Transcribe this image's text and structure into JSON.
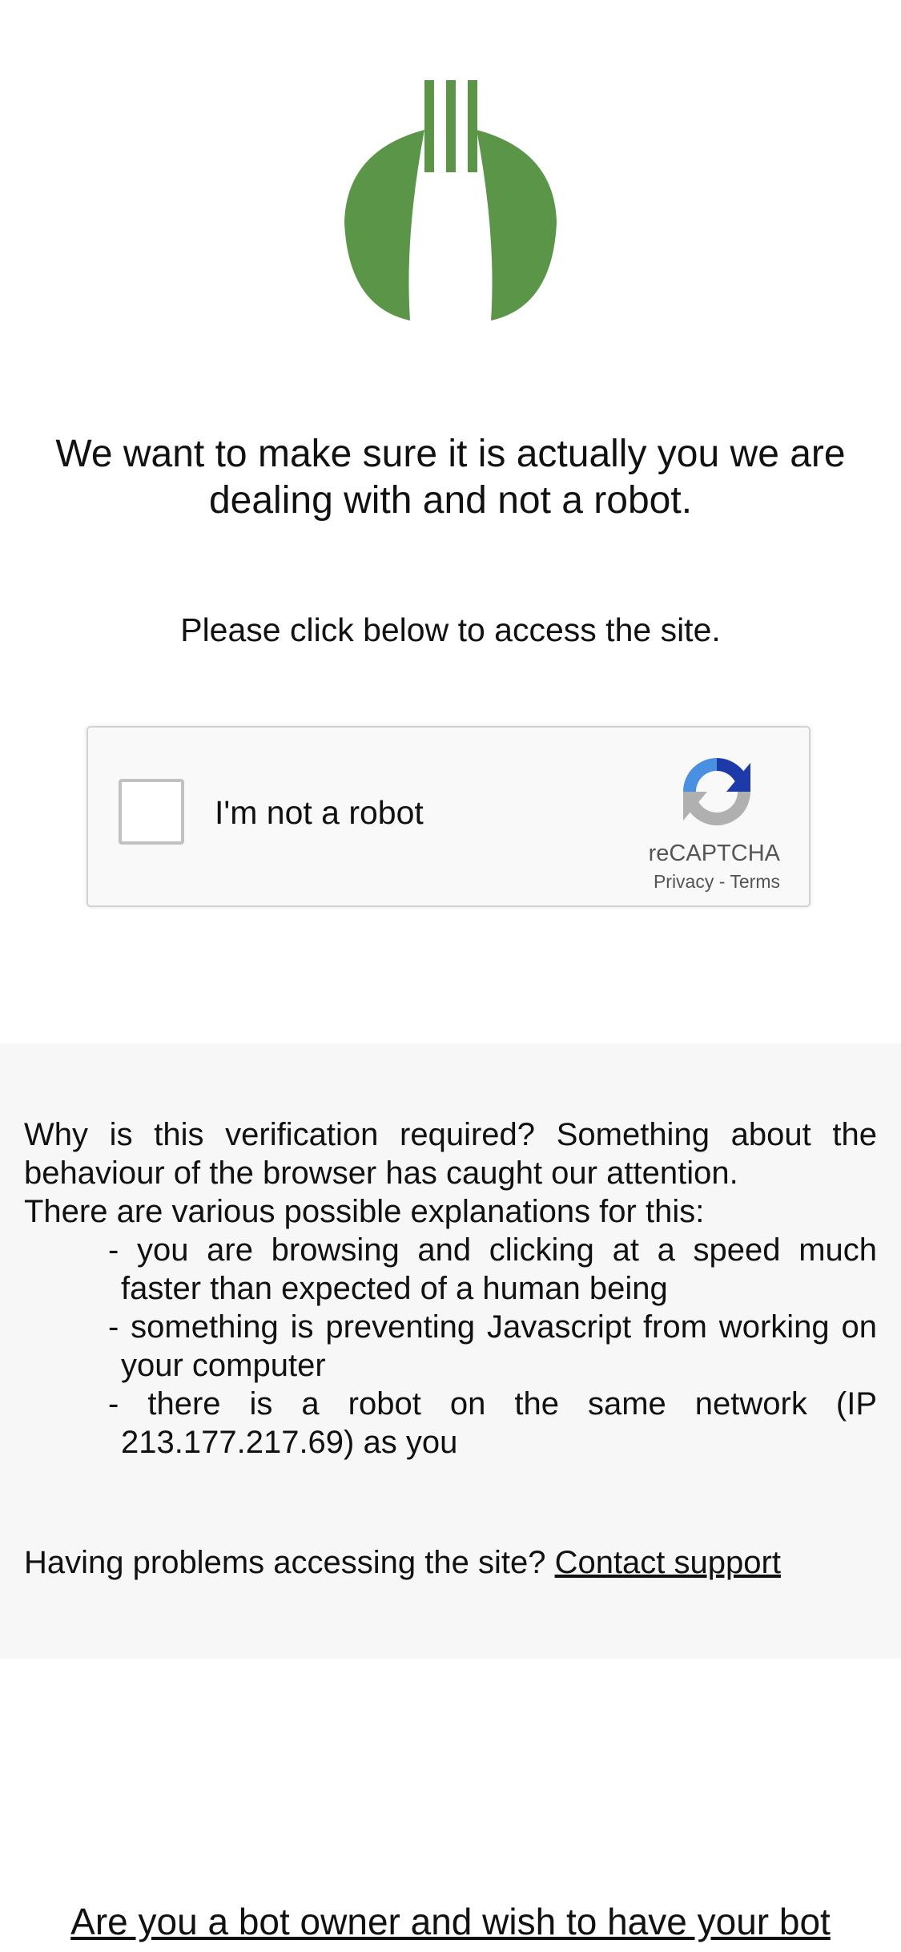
{
  "brand": {
    "logo_icon": "fork-leaf-logo-icon",
    "logo_color": "#5a9548"
  },
  "verification": {
    "headline": "We want to make sure it is actually you we are dealing with and not a robot.",
    "instruction": "Please click below to access the site."
  },
  "recaptcha": {
    "checkbox_label": "I'm not a robot",
    "checked": false,
    "brand_label": "reCAPTCHA",
    "privacy_label": "Privacy",
    "separator": " - ",
    "terms_label": "Terms",
    "logo_icon": "recaptcha-logo-icon"
  },
  "info": {
    "why_text": "Why is this verification required? Something about the behaviour of the browser has caught our attention.",
    "explanations_intro": "There are various possible explanations for this:",
    "reasons": [
      "- you are browsing and clicking at a speed much faster than expected of a human being",
      "- something is preventing Javascript from working on your computer",
      "- there is a robot on the same network (IP 213.177.217.69) as you"
    ],
    "problems_text": "Having problems accessing the site? ",
    "contact_link": "Contact support"
  },
  "footer": {
    "bot_owner_link": "Are you a bot owner and wish to have your bot"
  },
  "colors": {
    "panel_background": "#f7f7f7",
    "recaptcha_blue": "#1c3aa9",
    "recaptcha_lightblue": "#4a90e2",
    "recaptcha_gray": "#b0b0b0"
  }
}
